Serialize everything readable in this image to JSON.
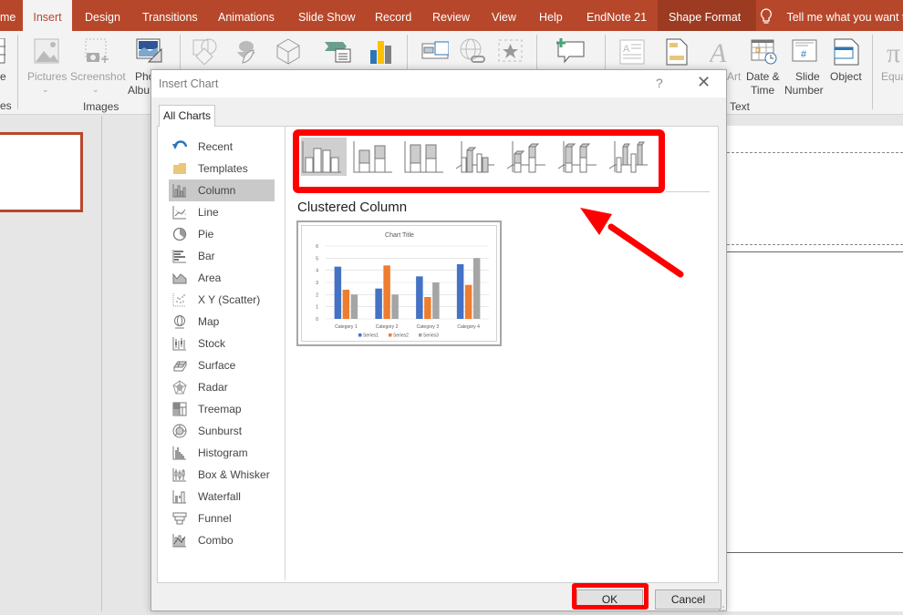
{
  "ribbon_tabs": [
    {
      "label": "me",
      "state": "normal"
    },
    {
      "label": "Insert",
      "state": "active"
    },
    {
      "label": "Design",
      "state": "normal"
    },
    {
      "label": "Transitions",
      "state": "normal"
    },
    {
      "label": "Animations",
      "state": "normal"
    },
    {
      "label": "Slide Show",
      "state": "normal"
    },
    {
      "label": "Record",
      "state": "normal"
    },
    {
      "label": "Review",
      "state": "normal"
    },
    {
      "label": "View",
      "state": "normal"
    },
    {
      "label": "Help",
      "state": "normal"
    },
    {
      "label": "EndNote 21",
      "state": "normal"
    },
    {
      "label": "Shape Format",
      "state": "contextual"
    }
  ],
  "tell_me": "Tell me what you want to",
  "ribbon": {
    "pictures": "Pictures",
    "screenshot": "Screenshot",
    "photo_album_1": "Pho",
    "photo_album_2": "Albu",
    "table_partial": "e",
    "art_partial": "Art",
    "date_time_1": "Date &",
    "date_time_2": "Time",
    "slide_number_1": "Slide",
    "slide_number_2": "Number",
    "object": "Object",
    "equation_partial": "Equa",
    "groups": {
      "tables_partial": "es",
      "images": "Images",
      "text": "Text"
    }
  },
  "dialog": {
    "title": "Insert Chart",
    "help": "?",
    "close": "✕",
    "tab": "All Charts",
    "chart_types": [
      {
        "label": "Recent",
        "icon": "recent-icon"
      },
      {
        "label": "Templates",
        "icon": "folder-icon"
      },
      {
        "label": "Column",
        "icon": "column-chart-icon",
        "selected": true
      },
      {
        "label": "Line",
        "icon": "line-chart-icon"
      },
      {
        "label": "Pie",
        "icon": "pie-chart-icon"
      },
      {
        "label": "Bar",
        "icon": "bar-chart-icon"
      },
      {
        "label": "Area",
        "icon": "area-chart-icon"
      },
      {
        "label": "X Y (Scatter)",
        "icon": "scatter-chart-icon"
      },
      {
        "label": "Map",
        "icon": "map-chart-icon"
      },
      {
        "label": "Stock",
        "icon": "stock-chart-icon"
      },
      {
        "label": "Surface",
        "icon": "surface-chart-icon"
      },
      {
        "label": "Radar",
        "icon": "radar-chart-icon"
      },
      {
        "label": "Treemap",
        "icon": "treemap-chart-icon"
      },
      {
        "label": "Sunburst",
        "icon": "sunburst-chart-icon"
      },
      {
        "label": "Histogram",
        "icon": "histogram-chart-icon"
      },
      {
        "label": "Box & Whisker",
        "icon": "box-whisker-chart-icon"
      },
      {
        "label": "Waterfall",
        "icon": "waterfall-chart-icon"
      },
      {
        "label": "Funnel",
        "icon": "funnel-chart-icon"
      },
      {
        "label": "Combo",
        "icon": "combo-chart-icon"
      }
    ],
    "subtypes": [
      {
        "name": "clustered-column",
        "selected": true
      },
      {
        "name": "stacked-column"
      },
      {
        "name": "100-stacked-column"
      },
      {
        "name": "3d-clustered-column"
      },
      {
        "name": "3d-stacked-column"
      },
      {
        "name": "3d-100-stacked-column"
      },
      {
        "name": "3d-column"
      }
    ],
    "selected_subtype_name": "Clustered Column",
    "ok": "OK",
    "cancel": "Cancel"
  },
  "highlight_color": "#ff0000",
  "accent_color": "#b7472a",
  "chart_data": {
    "type": "bar",
    "title": "Chart Title",
    "categories": [
      "Category 1",
      "Category 2",
      "Category 3",
      "Category 4"
    ],
    "series": [
      {
        "name": "Series1",
        "values": [
          4.3,
          2.5,
          3.5,
          4.5
        ],
        "color": "#4472c4"
      },
      {
        "name": "Series2",
        "values": [
          2.4,
          4.4,
          1.8,
          2.8
        ],
        "color": "#ed7d31"
      },
      {
        "name": "Series3",
        "values": [
          2,
          2,
          3,
          5
        ],
        "color": "#a5a5a5"
      }
    ],
    "yticks": [
      "0",
      "1",
      "2",
      "3",
      "4",
      "5",
      "6"
    ],
    "ylim": [
      0,
      6
    ],
    "grid": true,
    "legend": "bottom",
    "xlabel": "",
    "ylabel": ""
  }
}
